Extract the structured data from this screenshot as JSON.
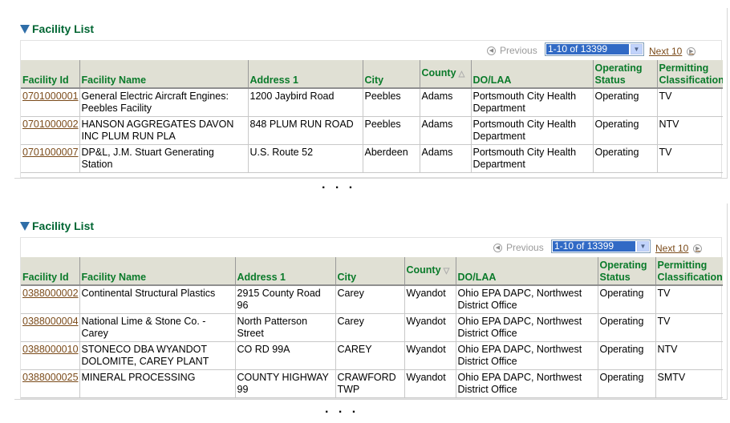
{
  "panels": [
    {
      "title": "Facility List",
      "pager": {
        "previous": "Previous",
        "range": "1-10 of 13399",
        "next": "Next 10"
      },
      "columns": [
        "Facility Id",
        "Facility Name",
        "Address 1",
        "City",
        "County",
        "DO/LAA",
        "Operating Status",
        "Permitting Classification"
      ],
      "sort_indicator": "ascending",
      "rows": [
        {
          "id": "0701000001",
          "name": "General Electric Aircraft Engines: Peebles Facility",
          "address": "1200 Jaybird Road",
          "city": "Peebles",
          "county": "Adams",
          "dolaa": "Portsmouth City Health Department",
          "status": "Operating",
          "class": "TV"
        },
        {
          "id": "0701000002",
          "name": "HANSON AGGREGATES DAVON INC PLUM RUN PLA",
          "address": "848 PLUM RUN ROAD",
          "city": "Peebles",
          "county": "Adams",
          "dolaa": "Portsmouth City Health Department",
          "status": "Operating",
          "class": "NTV"
        },
        {
          "id": "0701000007",
          "name": "DP&L, J.M. Stuart Generating Station",
          "address": "U.S. Route 52",
          "city": "Aberdeen",
          "county": "Adams",
          "dolaa": "Portsmouth City Health Department",
          "status": "Operating",
          "class": "TV"
        }
      ]
    },
    {
      "title": "Facility List",
      "pager": {
        "previous": "Previous",
        "range": "1-10 of 13399",
        "next": "Next 10"
      },
      "columns": [
        "Facility Id",
        "Facility Name",
        "Address 1",
        "City",
        "County",
        "DO/LAA",
        "Operating Status",
        "Permitting Classification"
      ],
      "sort_indicator": "descending",
      "rows": [
        {
          "id": "0388000002",
          "name": "Continental Structural Plastics",
          "address": "2915 County Road 96",
          "city": "Carey",
          "county": "Wyandot",
          "dolaa": "Ohio EPA DAPC, Northwest District Office",
          "status": "Operating",
          "class": "TV"
        },
        {
          "id": "0388000004",
          "name": "National Lime & Stone Co. - Carey",
          "address": "North Patterson Street",
          "city": "Carey",
          "county": "Wyandot",
          "dolaa": "Ohio EPA DAPC, Northwest District Office",
          "status": "Operating",
          "class": "TV"
        },
        {
          "id": "0388000010",
          "name": "STONECO DBA WYANDOT DOLOMITE, CAREY PLANT",
          "address": "CO RD 99A",
          "city": "CAREY",
          "county": "Wyandot",
          "dolaa": "Ohio EPA DAPC, Northwest District Office",
          "status": "Operating",
          "class": "NTV"
        },
        {
          "id": "0388000025",
          "name": "MINERAL PROCESSING",
          "address": "COUNTY HIGHWAY 99",
          "city": "CRAWFORD TWP",
          "county": "Wyandot",
          "dolaa": "Ohio EPA DAPC, Northwest District Office",
          "status": "Operating",
          "class": "SMTV"
        }
      ]
    }
  ],
  "ellipsis": ". . ."
}
